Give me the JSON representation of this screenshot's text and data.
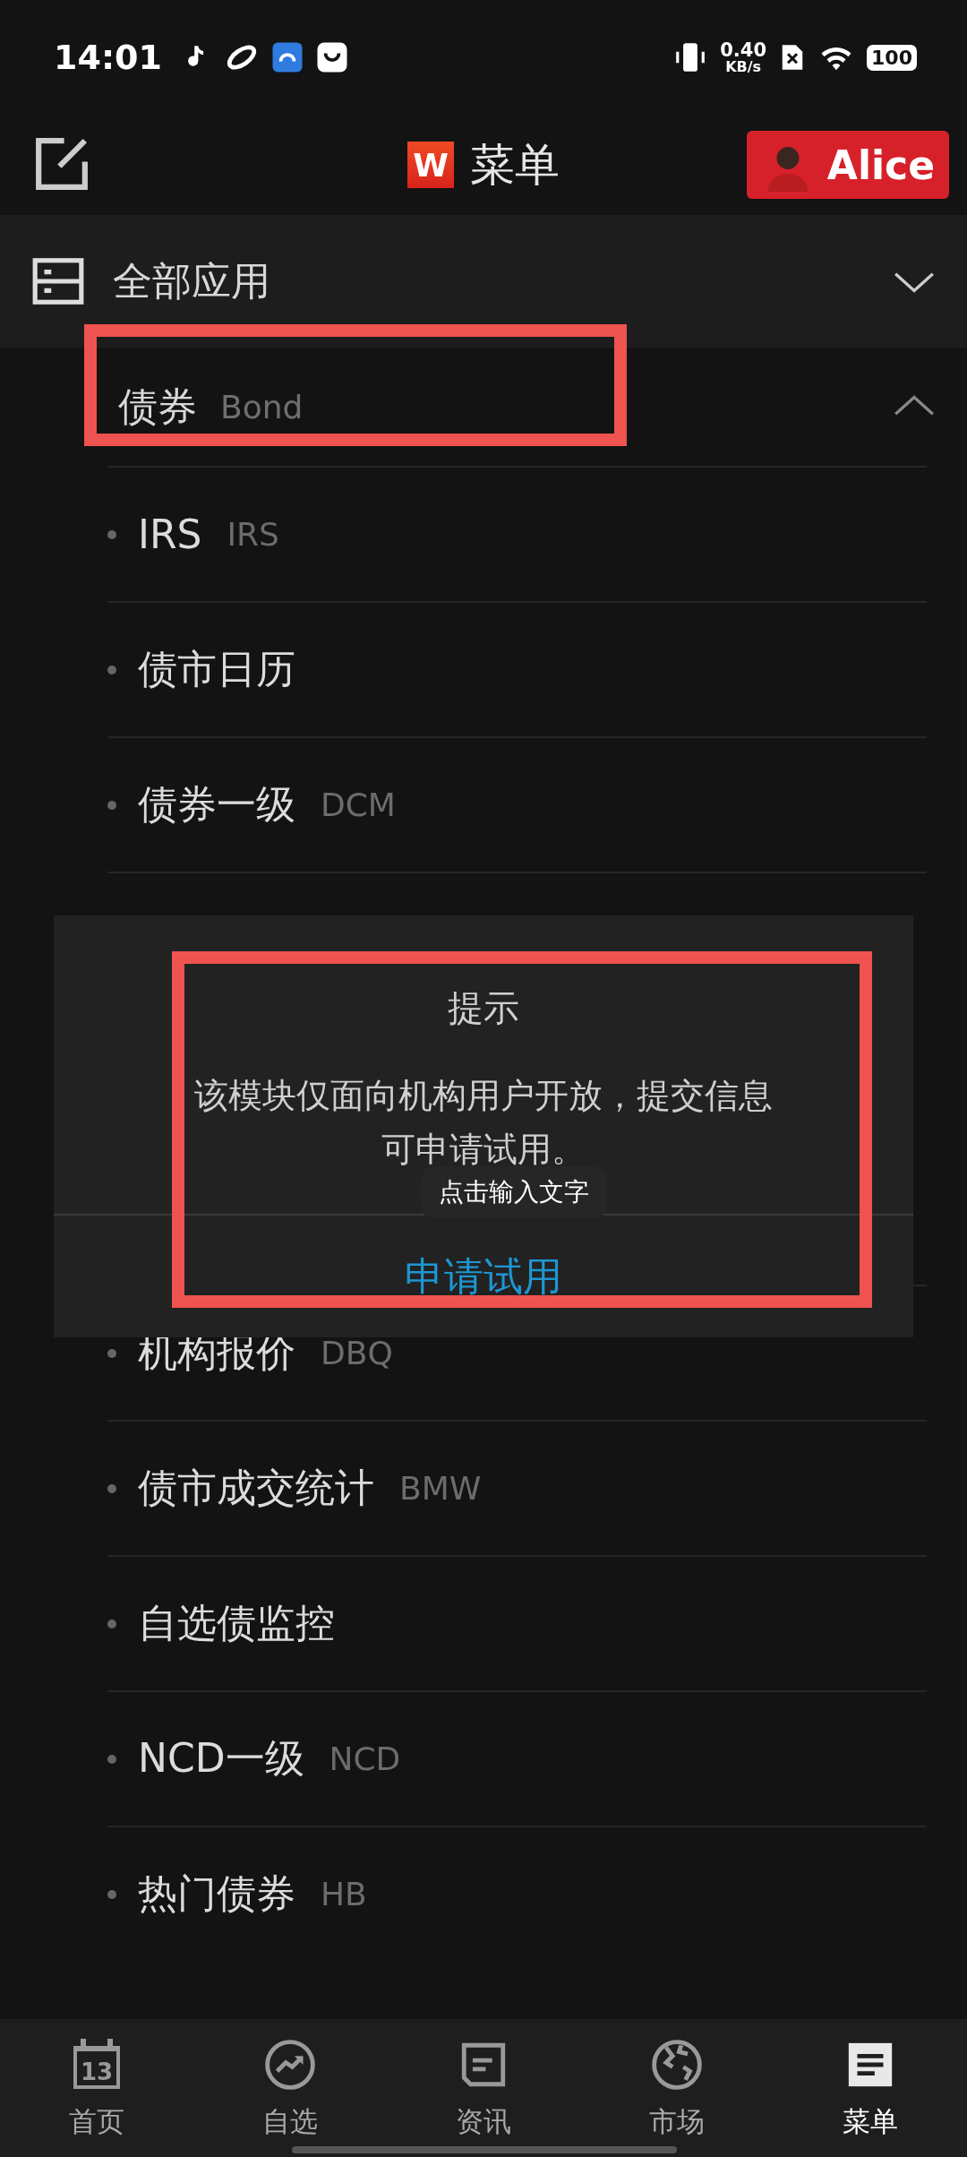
{
  "status_bar": {
    "time": "14:01",
    "net_speed_value": "0.40",
    "net_speed_unit": "KB/s",
    "battery": "100"
  },
  "header": {
    "logo": "W",
    "title": "菜单",
    "user_name": "Alice"
  },
  "all_apps": {
    "label": "全部应用",
    "expanded": false
  },
  "category": {
    "label": "债券",
    "label_en": "Bond",
    "expanded": true,
    "items_before_dialog": [
      {
        "label": "IRS",
        "code": "IRS"
      },
      {
        "label": "债市日历"
      },
      {
        "label": "债券一级",
        "code": "DCM"
      }
    ],
    "items_after_dialog": [
      {
        "label": "机构报价",
        "code": "DBQ"
      },
      {
        "label": "债市成交统计",
        "code": "BMW"
      },
      {
        "label": "自选债监控"
      },
      {
        "label": "NCD一级",
        "code": "NCD"
      },
      {
        "label": "热门债券",
        "code": "HB"
      }
    ]
  },
  "dialog": {
    "title": "提示",
    "message": "该模块仅面向机构用户开放，提交信息可申请试用。",
    "button": "申请试用"
  },
  "text_hint": "点击输入文字",
  "bottom_nav": [
    {
      "kind": "calendar",
      "label": "首页",
      "icon_text": "13",
      "selected": false
    },
    {
      "kind": "trend",
      "label": "自选",
      "selected": false
    },
    {
      "kind": "news",
      "label": "资讯",
      "selected": false
    },
    {
      "kind": "globe",
      "label": "市场",
      "selected": false
    },
    {
      "kind": "menu",
      "label": "菜单",
      "selected": true
    }
  ]
}
